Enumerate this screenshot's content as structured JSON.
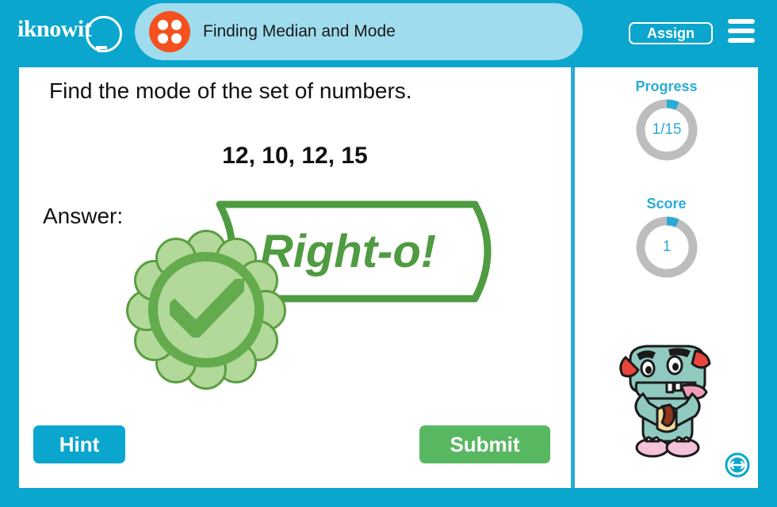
{
  "brand": {
    "logo_text": "iknowit",
    "logo_icon": "lightbulb-icon"
  },
  "header": {
    "lesson_icon": "four-dot-dice-icon",
    "title": "Finding Median and Mode",
    "assign_label": "Assign",
    "menu_icon": "hamburger-menu-icon"
  },
  "question": {
    "prompt": "Find the mode of the set of numbers.",
    "numbers": "12, 10, 12, 15",
    "answer_label": "Answer:"
  },
  "feedback": {
    "message": "Right-o!",
    "badge_icon": "check-badge-icon",
    "correct": true,
    "color": "#4f9b41"
  },
  "actions": {
    "hint_label": "Hint",
    "submit_label": "Submit"
  },
  "sidebar": {
    "progress_label": "Progress",
    "progress_value": "1/15",
    "progress_current": 1,
    "progress_total": 15,
    "score_label": "Score",
    "score_value": "1",
    "mascot_icon": "monster-mascot-icon",
    "resize_icon": "resize-horizontal-icon"
  },
  "colors": {
    "brand_cyan": "#0aa6ce",
    "tab_light_blue": "#9fdcee",
    "accent_orange": "#f4511e",
    "success_green": "#58b862",
    "feedback_green": "#4f9b41",
    "ring_track": "#bdbdbd",
    "ring_fill": "#29abd6"
  }
}
